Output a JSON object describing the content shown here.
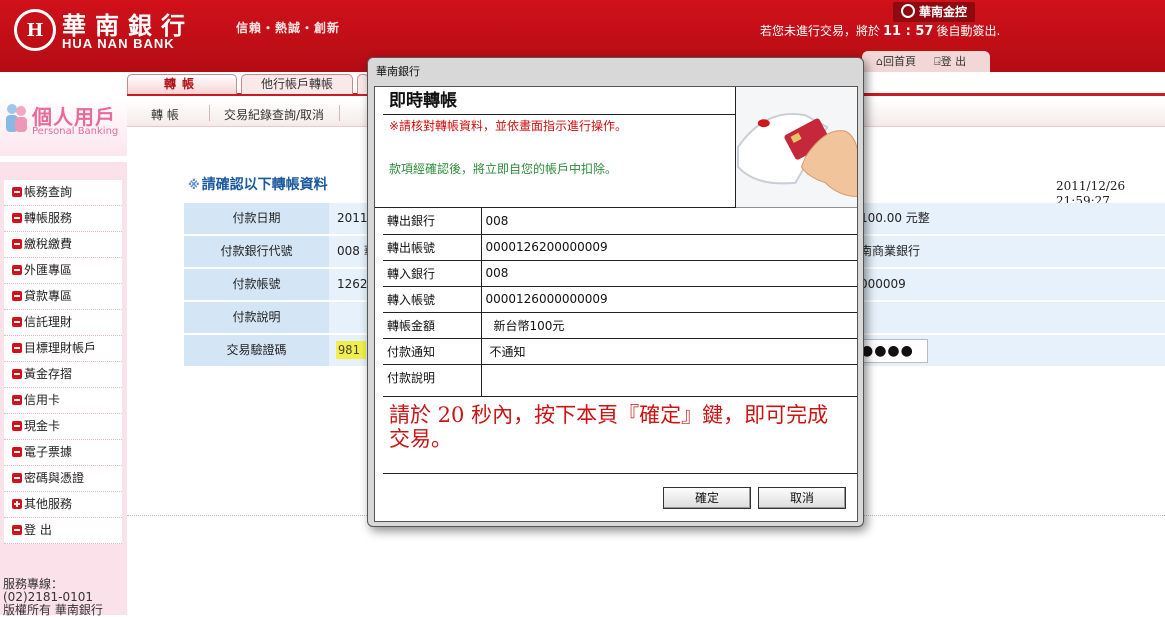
{
  "header": {
    "logo_mark": "H",
    "bank_name_cn": "華南銀行",
    "bank_name_en": "HUA NAN BANK",
    "slogan": "信賴・熱誠・創新",
    "group_name": "華南金控",
    "timeout_prefix": "若您未進行交易，將於",
    "timeout_time": "11 : 57",
    "timeout_suffix": "後自動簽出.",
    "home_link": "回首頁",
    "logout_link": "登 出"
  },
  "tabs": [
    {
      "label": "轉帳",
      "active": true
    },
    {
      "label": "他行帳戶轉帳",
      "active": false
    },
    {
      "label": "",
      "active": false
    }
  ],
  "sub_tabs": [
    "轉 帳",
    "交易紀錄查詢/取消"
  ],
  "sidebar": {
    "title_cn": "個人用戶",
    "title_en": "Personal Banking",
    "items": [
      "帳務查詢",
      "轉帳服務",
      "繳稅繳費",
      "外匯專區",
      "貸款專區",
      "信託理財",
      "目標理財帳戶",
      "黃金存摺",
      "信用卡",
      "現金卡",
      "電子票據",
      "密碼與憑證",
      "其他服務",
      "登 出"
    ],
    "hotline_label": "服務專線：",
    "hotline_number": "(02)2181-0101",
    "copyright": "版權所有 華南銀行"
  },
  "main": {
    "title": "請確認以下轉帳資料",
    "title_mark": "※",
    "datetime": "2011/12/26　21:59:27",
    "rows": [
      {
        "label": "付款日期",
        "value": "2011/1",
        "right": "100.00 元整"
      },
      {
        "label": "付款銀行代號",
        "value": "008 華",
        "right": "南商業銀行"
      },
      {
        "label": "付款帳號",
        "value": "12620",
        "right": "000009"
      },
      {
        "label": "付款說明",
        "value": "",
        "right": ""
      },
      {
        "label": "交易驗證碼",
        "value": "981",
        "right": "●●●●"
      }
    ]
  },
  "dialog": {
    "window_title": "華南銀行",
    "heading": "即時轉帳",
    "warning": "※請核對轉帳資料，並依畫面指示進行操作。",
    "note": "款項經確認後，將立即自您的帳戶中扣除。",
    "rows": [
      {
        "label": "轉出銀行",
        "value": "008"
      },
      {
        "label": "轉出帳號",
        "value": "0000126200000009"
      },
      {
        "label": "轉入銀行",
        "value": "008"
      },
      {
        "label": "轉入帳號",
        "value": "0000126000000009"
      },
      {
        "label": "轉帳金額",
        "value": "新台幣100元"
      },
      {
        "label": "付款通知",
        "value": "不通知"
      },
      {
        "label": "付款說明",
        "value": ""
      }
    ],
    "message": "請於 20 秒內，按下本頁『確定』鍵，即可完成交易。",
    "ok_label": "確定",
    "cancel_label": "取消"
  },
  "colors": {
    "brand_red": "#c40f17",
    "accent_blue": "#1c5a9e",
    "warning_red": "#d10f0f",
    "note_green": "#2e8b3a"
  }
}
